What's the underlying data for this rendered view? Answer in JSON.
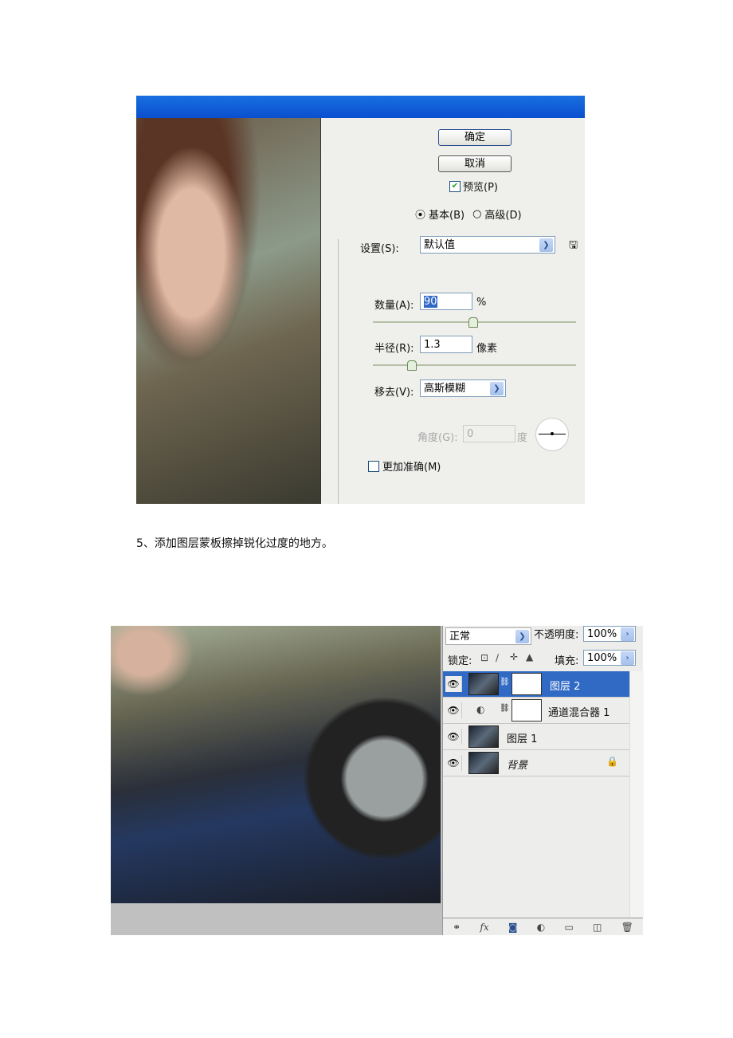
{
  "dialog": {
    "ok": "确定",
    "cancel": "取消",
    "preview": "预览(P)",
    "preview_checked": true,
    "mode_basic": "基本(B)",
    "mode_advanced": "高级(D)",
    "mode_selected": "basic",
    "settings_label": "设置(S):",
    "settings_value": "默认值",
    "amount_label": "数量(A):",
    "amount_value": "90",
    "amount_unit": "%",
    "radius_label": "半径(R):",
    "radius_value": "1.3",
    "radius_unit": "像素",
    "remove_label": "移去(V):",
    "remove_value": "高斯模糊",
    "angle_label": "角度(G):",
    "angle_value": "0",
    "angle_unit": "度",
    "more_accurate": "更加准确(M)",
    "more_accurate_checked": false,
    "title_bar_color": "#0a4fcf"
  },
  "caption": "5、添加图层蒙板擦掉锐化过度的地方。",
  "layers_panel": {
    "blend_mode": "正常",
    "opacity_label": "不透明度:",
    "opacity_value": "100%",
    "lock_label": "锁定:",
    "fill_label": "填充:",
    "fill_value": "100%",
    "layers": [
      {
        "name": "图层 2",
        "selected": true,
        "has_mask": true
      },
      {
        "name": "通道混合器 1",
        "adjustment": true,
        "has_mask": true
      },
      {
        "name": "图层 1"
      },
      {
        "name": "背景",
        "locked": true
      }
    ],
    "footer_icons": [
      "link-icon",
      "fx-icon",
      "mask-icon",
      "adjustment-icon",
      "folder-icon",
      "new-layer-icon",
      "trash-icon"
    ],
    "fx_label": "fx"
  }
}
